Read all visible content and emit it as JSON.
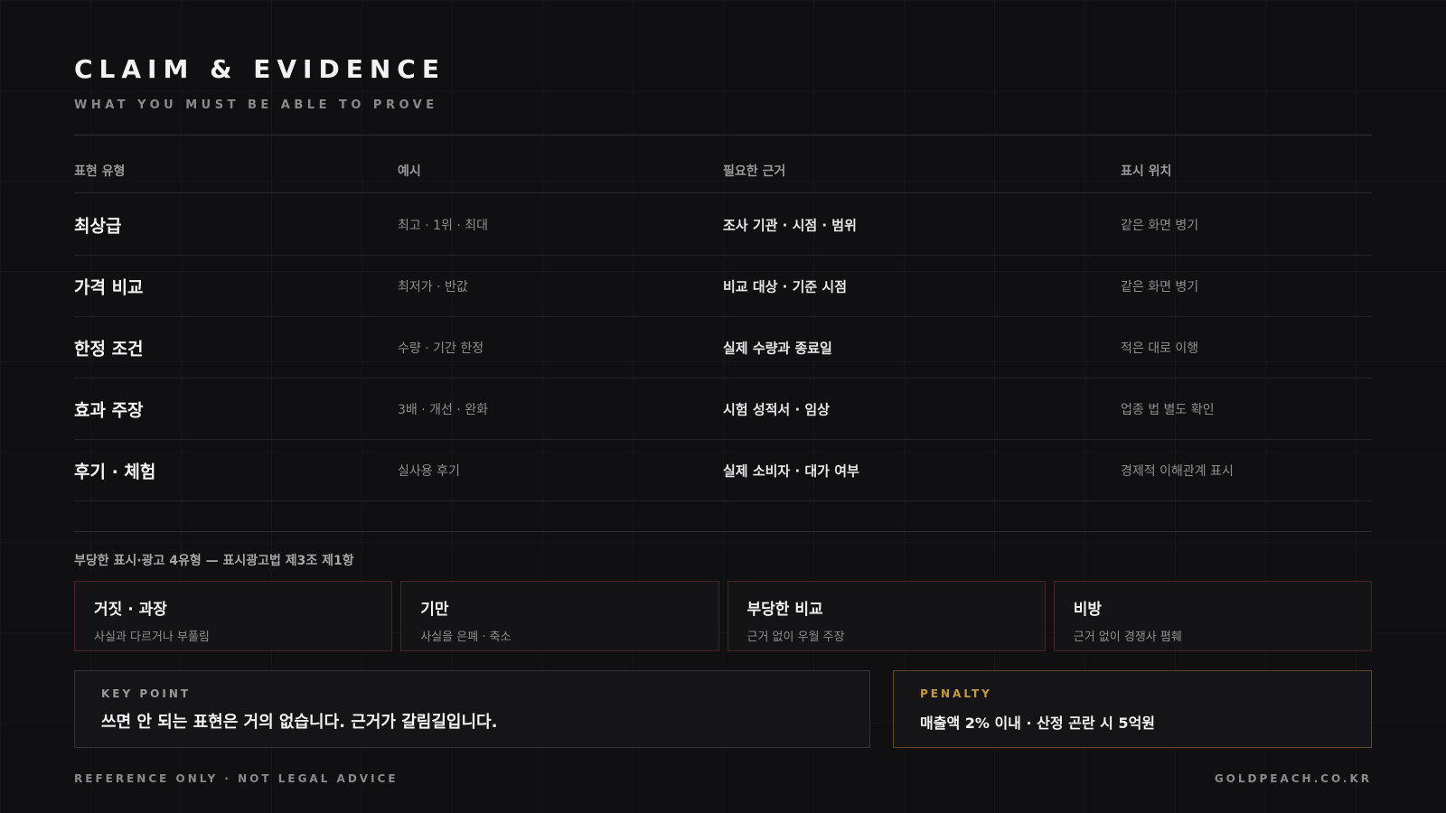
{
  "header": {
    "title": "CLAIM & EVIDENCE",
    "subtitle": "WHAT YOU MUST BE ABLE TO PROVE"
  },
  "table": {
    "columns": [
      "표현 유형",
      "예시",
      "필요한 근거",
      "표시 위치"
    ],
    "rows": [
      {
        "type": "최상급",
        "example": "최고 · 1위 · 최대",
        "evidence": "조사 기관 · 시점 · 범위",
        "placement": "같은 화면 병기"
      },
      {
        "type": "가격 비교",
        "example": "최저가 · 반값",
        "evidence": "비교 대상 · 기준 시점",
        "placement": "같은 화면 병기"
      },
      {
        "type": "한정 조건",
        "example": "수량 · 기간 한정",
        "evidence": "실제 수량과 종료일",
        "placement": "적은 대로 이행"
      },
      {
        "type": "효과 주장",
        "example": "3배 · 개선 · 완화",
        "evidence": "시험 성적서 · 임상",
        "placement": "업종 법 별도 확인"
      },
      {
        "type": "후기 · 체험",
        "example": "실사용 후기",
        "evidence": "실제 소비자 · 대가 여부",
        "placement": "경제적 이해관계 표시"
      }
    ]
  },
  "unfair_types": {
    "label": "부당한 표시·광고 4유형 — 표시광고법 제3조 제1항",
    "items": [
      {
        "name": "거짓 · 과장",
        "desc": "사실과 다르거나 부풀림"
      },
      {
        "name": "기만",
        "desc": "사실을 은폐 · 축소"
      },
      {
        "name": "부당한 비교",
        "desc": "근거 없이 우월 주장"
      },
      {
        "name": "비방",
        "desc": "근거 없이 경쟁사 폄훼"
      }
    ]
  },
  "key_point": {
    "label": "KEY POINT",
    "text": "쓰면 안 되는 표현은 거의 없습니다. 근거가 갈림길입니다."
  },
  "penalty": {
    "label": "PENALTY",
    "text": "매출액 2% 이내 · 산정 곤란 시 5억원"
  },
  "footer": {
    "left": "REFERENCE ONLY · NOT LEGAL ADVICE",
    "right": "GOLDPEACH.CO.KR"
  },
  "colors": {
    "background": "#101012",
    "accent_gold": "#c99a3a",
    "card_border_red": "#4a2424",
    "penalty_border": "#5a4a22"
  }
}
